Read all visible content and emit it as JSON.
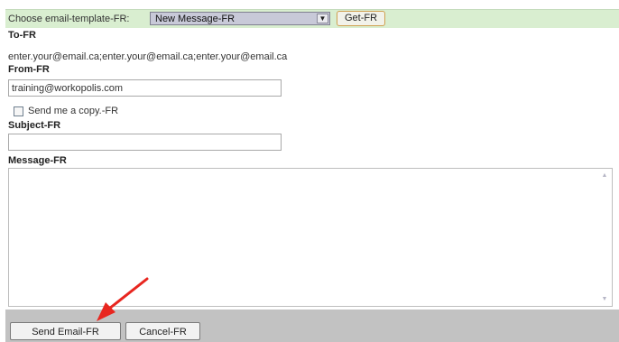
{
  "template_bar": {
    "label": "Choose email-template-FR:",
    "selected_template": "New Message-FR",
    "get_button": "Get-FR"
  },
  "to": {
    "label": "To-FR",
    "value": "enter.your@email.ca;enter.your@email.ca;enter.your@email.ca"
  },
  "from": {
    "label": "From-FR",
    "value": "training@workopolis.com"
  },
  "copy": {
    "label": "Send me a copy.-FR",
    "checked": false
  },
  "subject": {
    "label": "Subject-FR",
    "value": ""
  },
  "message": {
    "label": "Message-FR",
    "value": ""
  },
  "actions": {
    "send": "Send Email-FR",
    "cancel": "Cancel-FR"
  },
  "annotation": {
    "arrow_color": "#e8261f"
  },
  "colors": {
    "template_bar_bg": "#d9eed0",
    "bottom_bar_bg": "#c2c2c2"
  }
}
